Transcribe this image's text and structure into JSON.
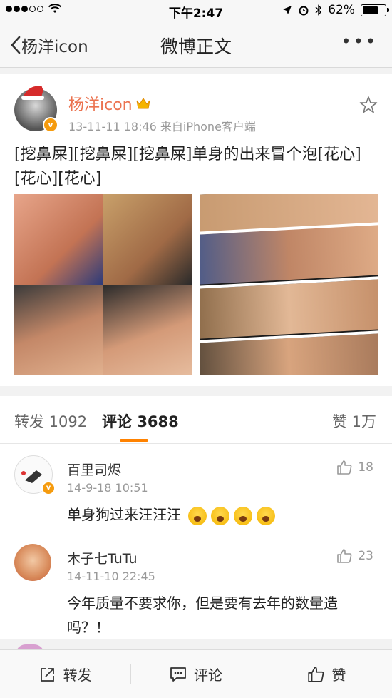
{
  "status_bar": {
    "time": "下午2:47",
    "battery": "62%"
  },
  "nav": {
    "back_label": "杨洋icon",
    "title": "微博正文",
    "more_label": "•••"
  },
  "post": {
    "username": "杨洋icon",
    "meta": "13-11-11 18:46  来自iPhone客户端",
    "content": "[挖鼻屎][挖鼻屎][挖鼻屎]单身的出来冒个泡[花心][花心][花心]",
    "photo_count": 2
  },
  "stats": {
    "repost": "转发 1092",
    "comments_label": "评论",
    "comments_count": "3688",
    "likes": "赞 1万"
  },
  "comments": [
    {
      "name": "百里司烬",
      "time": "14-9-18 10:51",
      "text": "单身狗过来汪汪汪",
      "likes": "18",
      "emoji_count": 4
    },
    {
      "name": "木子七TuTu",
      "time": "14-11-10 22:45",
      "text": "今年质量不要求你，但是要有去年的数量造吗？！",
      "likes": "23"
    }
  ],
  "toolbar": {
    "repost": "转发",
    "comment": "评论",
    "like": "赞"
  },
  "colors": {
    "username": "#eb7350",
    "accent": "#ff8200",
    "verified": "#f59b0e"
  }
}
